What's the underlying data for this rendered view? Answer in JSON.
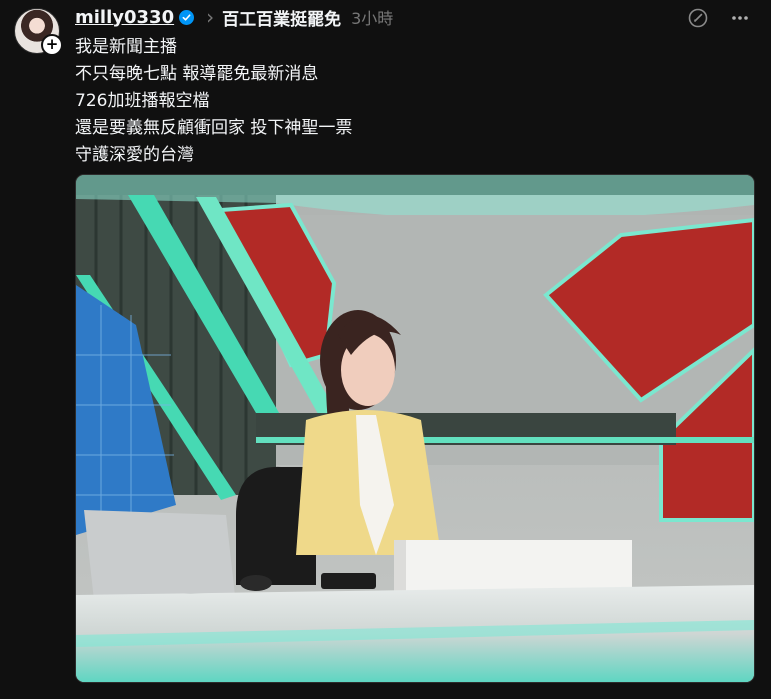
{
  "post": {
    "author": {
      "username": "milly0330",
      "verified": true
    },
    "topic": "百工百業挺罷免",
    "time": "3小時",
    "text_lines": [
      "我是新聞主播",
      "不只每晚七點 報導罷免最新消息",
      "726加班播報空檔",
      "還是要義無反顧衝回家 投下神聖一票",
      "守護深愛的台灣"
    ],
    "icons": {
      "avatar_add": "plus-icon",
      "verified": "verified-badge-icon",
      "separator": "chevron-right-icon",
      "edit": "edit-icon",
      "more": "more-horizontal-icon"
    },
    "image": {
      "subject": "news-anchor-studio-photo"
    }
  },
  "colors": {
    "background": "#101010",
    "text": "#f3f5f7",
    "muted": "#777777",
    "verified": "#0095f6"
  }
}
